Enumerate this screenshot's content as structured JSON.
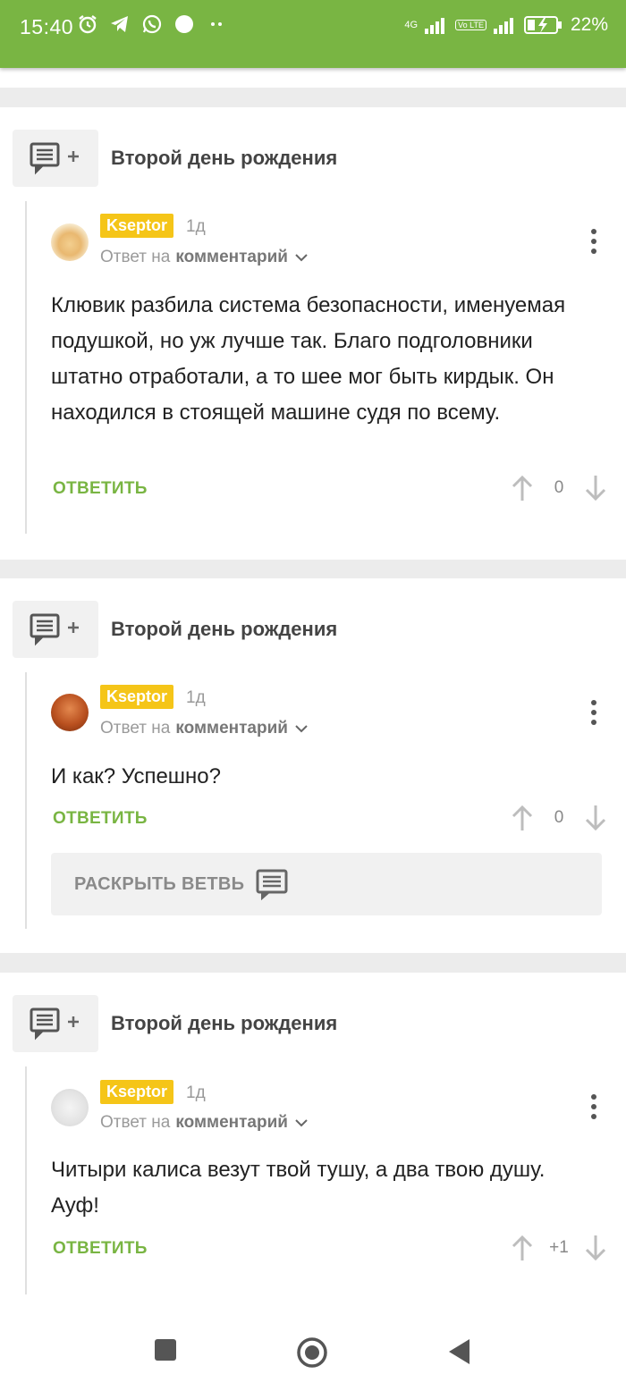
{
  "status_bar": {
    "time": "15:40",
    "network_1": "4G",
    "network_2": "Vo LTE",
    "battery": "22%"
  },
  "comments": [
    {
      "story_title": "Второй день рождения",
      "author": "Kseptor",
      "time_ago": "1д",
      "reply_prefix": "Ответ на",
      "reply_link": "комментарий",
      "text": "Клювик разбила система безопасности, именуемая подушкой, но уж лучше так. Благо подголовники штатно отработали, а то шее мог быть кирдык. Он находился в стоящей машине судя по всему.",
      "answer_label": "ОТВЕТИТЬ",
      "score": "0"
    },
    {
      "story_title": "Второй день рождения",
      "author": "Kseptor",
      "time_ago": "1д",
      "reply_prefix": "Ответ на",
      "reply_link": "комментарий",
      "text": "И как? Успешно?",
      "answer_label": "ОТВЕТИТЬ",
      "score": "0",
      "expand_label": "РАСКРЫТЬ ВЕТВЬ"
    },
    {
      "story_title": "Второй день рождения",
      "author": "Kseptor",
      "time_ago": "1д",
      "reply_prefix": "Ответ на",
      "reply_link": "комментарий",
      "text": "Читыри калиса везут твой тушу, а два твою душу. Ауф!",
      "answer_label": "ОТВЕТИТЬ",
      "score": "+1"
    }
  ],
  "colors": {
    "brand_green": "#79b543",
    "author_badge": "#f5c518"
  }
}
